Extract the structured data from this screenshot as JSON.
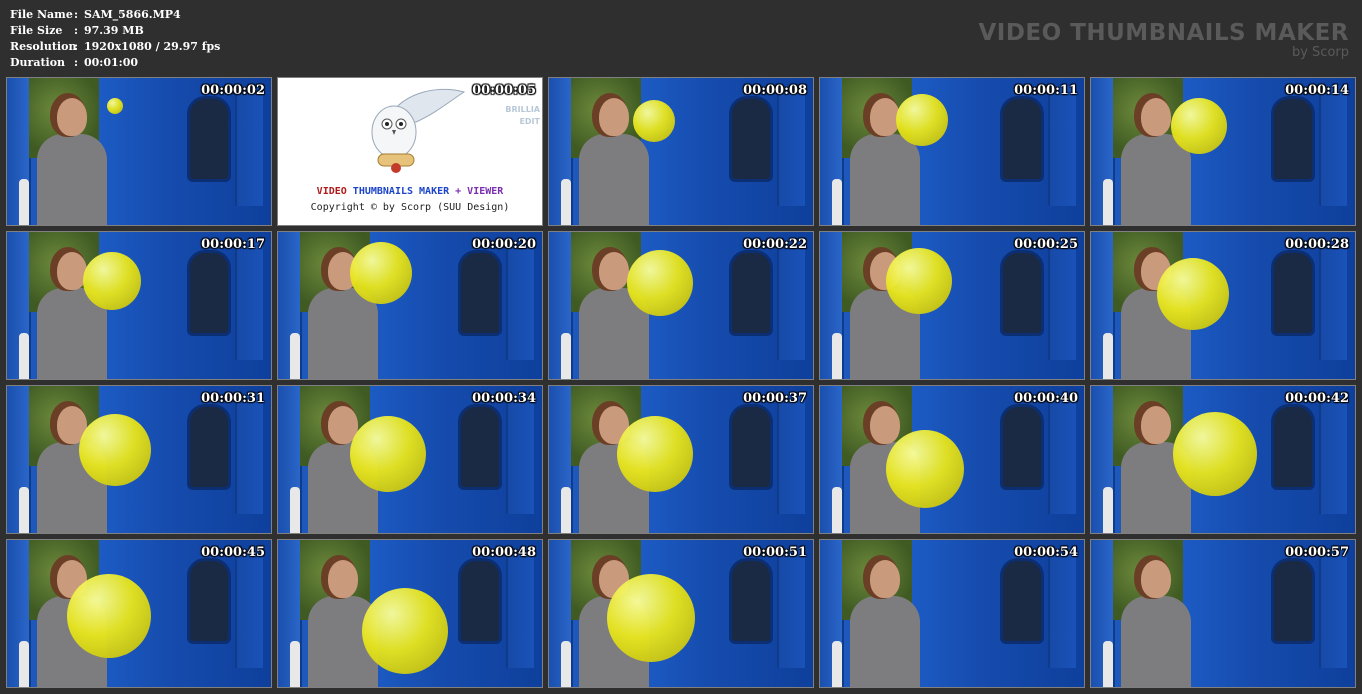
{
  "info": {
    "rows": [
      {
        "key": "File Name",
        "sep": ":",
        "value": "SAM_5866.MP4"
      },
      {
        "key": "File Size",
        "sep": ":",
        "value": "97.39 MB"
      },
      {
        "key": "Resolution",
        "sep": ":",
        "value": "1920x1080 / 29.97 fps"
      },
      {
        "key": "Duration",
        "sep": ":",
        "value": "00:01:00"
      }
    ]
  },
  "brand": {
    "title": "VIDEO THUMBNAILS MAKER",
    "subtitle": "by Scorp"
  },
  "splash": {
    "title_part1": "VIDEO ",
    "title_part2": "THUMBNAILS MAKER",
    "title_part3": " + VIEWER",
    "copyright": "Copyright © by Scorp (SUU Design)",
    "side_line1": "BRILLIA",
    "side_line2": "EDIT",
    "timestamp": "00:00:05"
  },
  "thumbnails": [
    {
      "timestamp": "00:00:02"
    },
    {
      "timestamp": "00:00:05"
    },
    {
      "timestamp": "00:00:08"
    },
    {
      "timestamp": "00:00:11"
    },
    {
      "timestamp": "00:00:14"
    },
    {
      "timestamp": "00:00:17"
    },
    {
      "timestamp": "00:00:20"
    },
    {
      "timestamp": "00:00:22"
    },
    {
      "timestamp": "00:00:25"
    },
    {
      "timestamp": "00:00:28"
    },
    {
      "timestamp": "00:00:31"
    },
    {
      "timestamp": "00:00:34"
    },
    {
      "timestamp": "00:00:37"
    },
    {
      "timestamp": "00:00:40"
    },
    {
      "timestamp": "00:00:42"
    },
    {
      "timestamp": "00:00:45"
    },
    {
      "timestamp": "00:00:48"
    },
    {
      "timestamp": "00:00:51"
    },
    {
      "timestamp": "00:00:54"
    },
    {
      "timestamp": "00:00:57"
    }
  ],
  "colors": {
    "background": "#2f2f2f",
    "balloon": "#e8e61c",
    "train_blue": "#1c5bc4"
  }
}
